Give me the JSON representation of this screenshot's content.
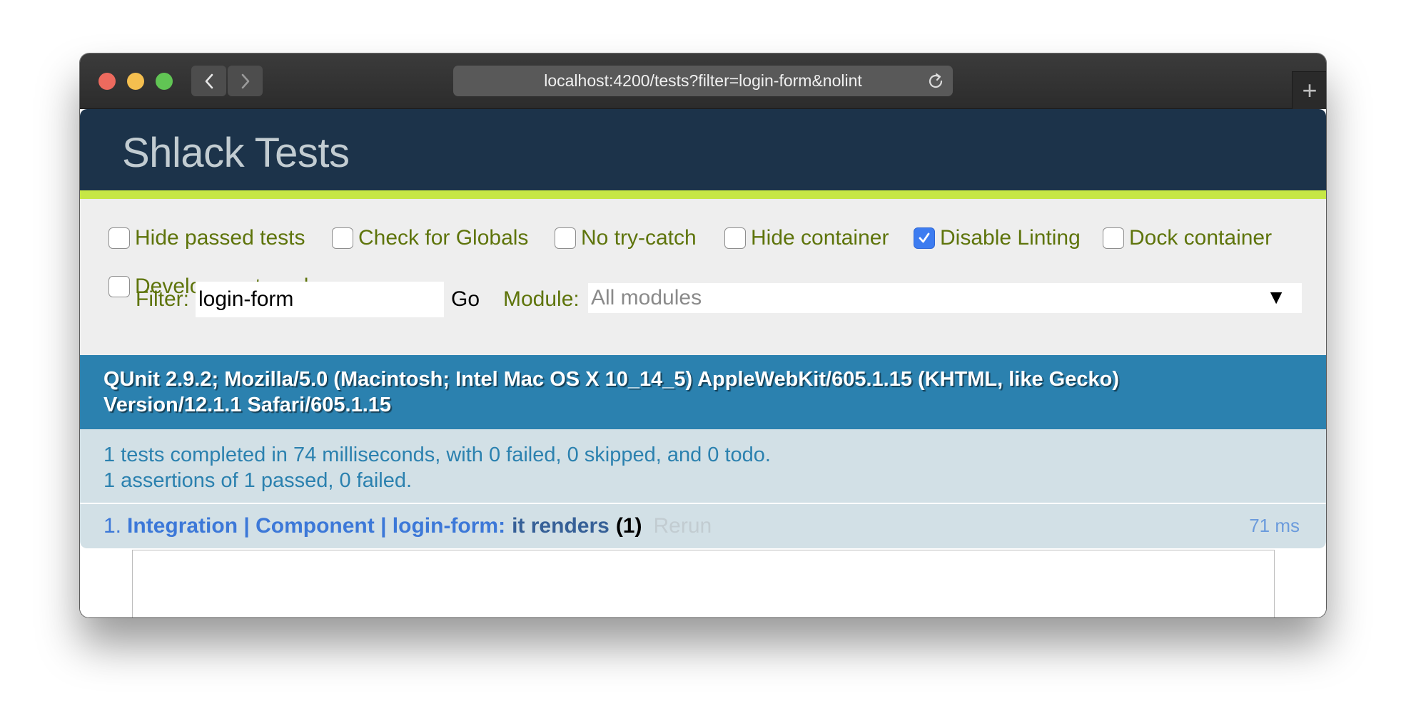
{
  "browser": {
    "url": "localhost:4200/tests?filter=login-form&nolint",
    "newtab_label": "+",
    "back_icon": "chevron-left-icon",
    "forward_icon": "chevron-right-icon",
    "reload_icon": "reload-icon"
  },
  "header": {
    "title": "Shlack Tests"
  },
  "toolbar": {
    "options": [
      {
        "label": "Hide passed tests",
        "checked": false
      },
      {
        "label": "Check for Globals",
        "checked": false
      },
      {
        "label": "No try-catch",
        "checked": false
      },
      {
        "label": "Hide container",
        "checked": false
      },
      {
        "label": "Disable Linting",
        "checked": true
      },
      {
        "label": "Dock container",
        "checked": false
      },
      {
        "label": "Development mode",
        "checked": false
      }
    ],
    "filter_label": "Filter:",
    "filter_value": "login-form",
    "go_label": "Go",
    "module_label": "Module:",
    "module_value": "All modules",
    "module_arrow": "▼"
  },
  "user_agent": {
    "line1": "QUnit 2.9.2; Mozilla/5.0 (Macintosh; Intel Mac OS X 10_14_5) AppleWebKit/605.1.15 (KHTML, like Gecko)",
    "line2": "Version/12.1.1 Safari/605.1.15"
  },
  "summary": {
    "line1": "1 tests completed in 74 milliseconds, with 0 failed, 0 skipped, and 0 todo.",
    "line2": "1 assertions of 1 passed, 0 failed."
  },
  "tests": [
    {
      "number": "1.",
      "module": "Integration | Component | login-form:",
      "name": "it renders",
      "counts": "(1)",
      "rerun": "Rerun",
      "runtime": "71 ms"
    }
  ],
  "colors": {
    "header_bg": "#1c334a",
    "header_accent": "#c6e746",
    "toolbar_text": "#5e740b",
    "useragent_bg": "#2b81af",
    "result_bg": "#d2e0e6",
    "checkbox_checked": "#3d7cf0"
  }
}
